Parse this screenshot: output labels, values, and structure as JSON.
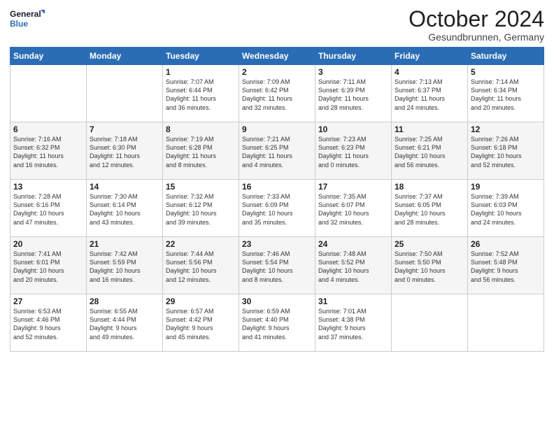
{
  "logo": {
    "line1": "General",
    "line2": "Blue"
  },
  "title": "October 2024",
  "subtitle": "Gesundbrunnen, Germany",
  "weekdays": [
    "Sunday",
    "Monday",
    "Tuesday",
    "Wednesday",
    "Thursday",
    "Friday",
    "Saturday"
  ],
  "weeks": [
    [
      {
        "day": "",
        "content": ""
      },
      {
        "day": "",
        "content": ""
      },
      {
        "day": "1",
        "content": "Sunrise: 7:07 AM\nSunset: 6:44 PM\nDaylight: 11 hours\nand 36 minutes."
      },
      {
        "day": "2",
        "content": "Sunrise: 7:09 AM\nSunset: 6:42 PM\nDaylight: 11 hours\nand 32 minutes."
      },
      {
        "day": "3",
        "content": "Sunrise: 7:11 AM\nSunset: 6:39 PM\nDaylight: 11 hours\nand 28 minutes."
      },
      {
        "day": "4",
        "content": "Sunrise: 7:13 AM\nSunset: 6:37 PM\nDaylight: 11 hours\nand 24 minutes."
      },
      {
        "day": "5",
        "content": "Sunrise: 7:14 AM\nSunset: 6:34 PM\nDaylight: 11 hours\nand 20 minutes."
      }
    ],
    [
      {
        "day": "6",
        "content": "Sunrise: 7:16 AM\nSunset: 6:32 PM\nDaylight: 11 hours\nand 16 minutes."
      },
      {
        "day": "7",
        "content": "Sunrise: 7:18 AM\nSunset: 6:30 PM\nDaylight: 11 hours\nand 12 minutes."
      },
      {
        "day": "8",
        "content": "Sunrise: 7:19 AM\nSunset: 6:28 PM\nDaylight: 11 hours\nand 8 minutes."
      },
      {
        "day": "9",
        "content": "Sunrise: 7:21 AM\nSunset: 6:25 PM\nDaylight: 11 hours\nand 4 minutes."
      },
      {
        "day": "10",
        "content": "Sunrise: 7:23 AM\nSunset: 6:23 PM\nDaylight: 11 hours\nand 0 minutes."
      },
      {
        "day": "11",
        "content": "Sunrise: 7:25 AM\nSunset: 6:21 PM\nDaylight: 10 hours\nand 56 minutes."
      },
      {
        "day": "12",
        "content": "Sunrise: 7:26 AM\nSunset: 6:18 PM\nDaylight: 10 hours\nand 52 minutes."
      }
    ],
    [
      {
        "day": "13",
        "content": "Sunrise: 7:28 AM\nSunset: 6:16 PM\nDaylight: 10 hours\nand 47 minutes."
      },
      {
        "day": "14",
        "content": "Sunrise: 7:30 AM\nSunset: 6:14 PM\nDaylight: 10 hours\nand 43 minutes."
      },
      {
        "day": "15",
        "content": "Sunrise: 7:32 AM\nSunset: 6:12 PM\nDaylight: 10 hours\nand 39 minutes."
      },
      {
        "day": "16",
        "content": "Sunrise: 7:33 AM\nSunset: 6:09 PM\nDaylight: 10 hours\nand 35 minutes."
      },
      {
        "day": "17",
        "content": "Sunrise: 7:35 AM\nSunset: 6:07 PM\nDaylight: 10 hours\nand 32 minutes."
      },
      {
        "day": "18",
        "content": "Sunrise: 7:37 AM\nSunset: 6:05 PM\nDaylight: 10 hours\nand 28 minutes."
      },
      {
        "day": "19",
        "content": "Sunrise: 7:39 AM\nSunset: 6:03 PM\nDaylight: 10 hours\nand 24 minutes."
      }
    ],
    [
      {
        "day": "20",
        "content": "Sunrise: 7:41 AM\nSunset: 6:01 PM\nDaylight: 10 hours\nand 20 minutes."
      },
      {
        "day": "21",
        "content": "Sunrise: 7:42 AM\nSunset: 5:59 PM\nDaylight: 10 hours\nand 16 minutes."
      },
      {
        "day": "22",
        "content": "Sunrise: 7:44 AM\nSunset: 5:56 PM\nDaylight: 10 hours\nand 12 minutes."
      },
      {
        "day": "23",
        "content": "Sunrise: 7:46 AM\nSunset: 5:54 PM\nDaylight: 10 hours\nand 8 minutes."
      },
      {
        "day": "24",
        "content": "Sunrise: 7:48 AM\nSunset: 5:52 PM\nDaylight: 10 hours\nand 4 minutes."
      },
      {
        "day": "25",
        "content": "Sunrise: 7:50 AM\nSunset: 5:50 PM\nDaylight: 10 hours\nand 0 minutes."
      },
      {
        "day": "26",
        "content": "Sunrise: 7:52 AM\nSunset: 5:48 PM\nDaylight: 9 hours\nand 56 minutes."
      }
    ],
    [
      {
        "day": "27",
        "content": "Sunrise: 6:53 AM\nSunset: 4:46 PM\nDaylight: 9 hours\nand 52 minutes."
      },
      {
        "day": "28",
        "content": "Sunrise: 6:55 AM\nSunset: 4:44 PM\nDaylight: 9 hours\nand 49 minutes."
      },
      {
        "day": "29",
        "content": "Sunrise: 6:57 AM\nSunset: 4:42 PM\nDaylight: 9 hours\nand 45 minutes."
      },
      {
        "day": "30",
        "content": "Sunrise: 6:59 AM\nSunset: 4:40 PM\nDaylight: 9 hours\nand 41 minutes."
      },
      {
        "day": "31",
        "content": "Sunrise: 7:01 AM\nSunset: 4:38 PM\nDaylight: 9 hours\nand 37 minutes."
      },
      {
        "day": "",
        "content": ""
      },
      {
        "day": "",
        "content": ""
      }
    ]
  ]
}
